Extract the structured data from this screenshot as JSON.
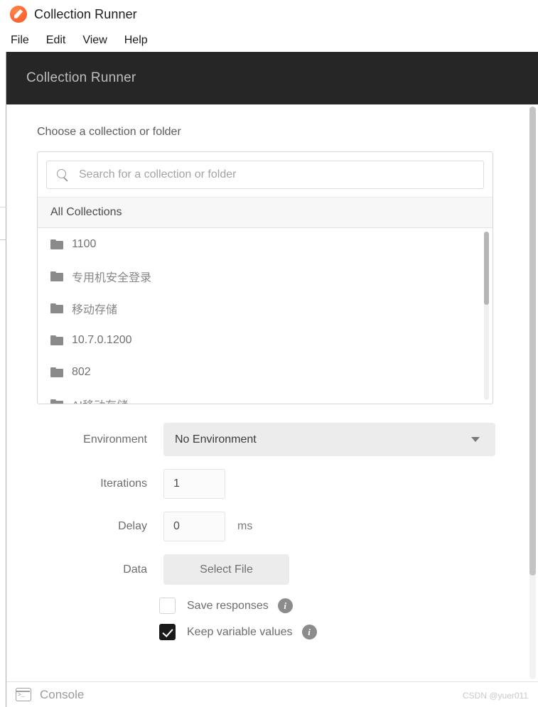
{
  "window": {
    "title": "Collection Runner",
    "logo_icon": "postman-logo-icon",
    "menu": [
      {
        "label": "File"
      },
      {
        "label": "Edit"
      },
      {
        "label": "View"
      },
      {
        "label": "Help"
      }
    ]
  },
  "header": {
    "title": "Collection Runner"
  },
  "picker": {
    "section_label": "Choose a collection or folder",
    "search_icon": "search-icon",
    "search_value": "",
    "search_placeholder": "Search for a collection or folder",
    "group_header": "All Collections",
    "items": [
      {
        "label": "1100",
        "icon": "folder-icon"
      },
      {
        "label": "专用机安全登录",
        "icon": "folder-icon"
      },
      {
        "label": "移动存储",
        "icon": "folder-icon"
      },
      {
        "label": "10.7.0.1200",
        "icon": "folder-icon"
      },
      {
        "label": "802",
        "icon": "folder-icon"
      },
      {
        "label": "AI移动存储",
        "icon": "folder-icon"
      }
    ]
  },
  "form": {
    "environment": {
      "label": "Environment",
      "value": "No Environment",
      "caret_icon": "chevron-down-icon"
    },
    "iterations": {
      "label": "Iterations",
      "value": "1"
    },
    "delay": {
      "label": "Delay",
      "value": "0",
      "unit": "ms"
    },
    "data": {
      "label": "Data",
      "button_label": "Select File"
    },
    "save_responses": {
      "label": "Save responses",
      "checked": false,
      "info_icon": "info-icon",
      "info_glyph": "i"
    },
    "keep_variable_values": {
      "label": "Keep variable values",
      "checked": true,
      "info_icon": "info-icon",
      "info_glyph": "i"
    }
  },
  "footer": {
    "console_icon": "console-icon",
    "console_label": "Console",
    "watermark": "CSDN @yuer011"
  },
  "colors": {
    "brand_orange": "#ff6c37",
    "header_dark": "#262626",
    "control_gray": "#ececec",
    "text_gray": "#6d6d6d"
  }
}
